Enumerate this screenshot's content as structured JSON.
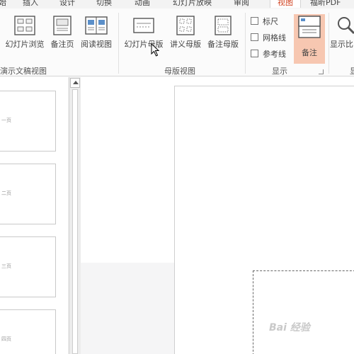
{
  "ribbon": {
    "tabs": [
      {
        "label": "始",
        "active": false
      },
      {
        "label": "插入",
        "active": false
      },
      {
        "label": "设计",
        "active": false
      },
      {
        "label": "切换",
        "active": false
      },
      {
        "label": "动画",
        "active": false
      },
      {
        "label": "幻灯片放映",
        "active": false
      },
      {
        "label": "审阅",
        "active": false
      },
      {
        "label": "视图",
        "active": true
      },
      {
        "label": "福昕PDF",
        "active": false
      }
    ],
    "presentation_views": {
      "group_label": "演示文稿视图",
      "buttons": [
        "幻灯片浏览",
        "备注页",
        "阅读视图"
      ]
    },
    "master_views": {
      "group_label": "母版视图",
      "buttons": [
        "幻灯片母版",
        "讲义母版",
        "备注母版"
      ]
    },
    "show": {
      "group_label": "显示",
      "checkboxes": [
        {
          "label": "标尺",
          "checked": false
        },
        {
          "label": "网格线",
          "checked": false
        },
        {
          "label": "参考线",
          "checked": false
        }
      ],
      "notes_button": "备注",
      "notes_active": true
    },
    "zoom": {
      "button": "显示比",
      "group_label": "显"
    }
  },
  "thumbnails": [
    {
      "label": "一页"
    },
    {
      "label": "二页"
    },
    {
      "label": "三页"
    },
    {
      "label": "四页"
    }
  ],
  "watermark": "Bai 经验",
  "colors": {
    "accent": "#d24726",
    "notes_highlight": "#f7c7b1"
  }
}
